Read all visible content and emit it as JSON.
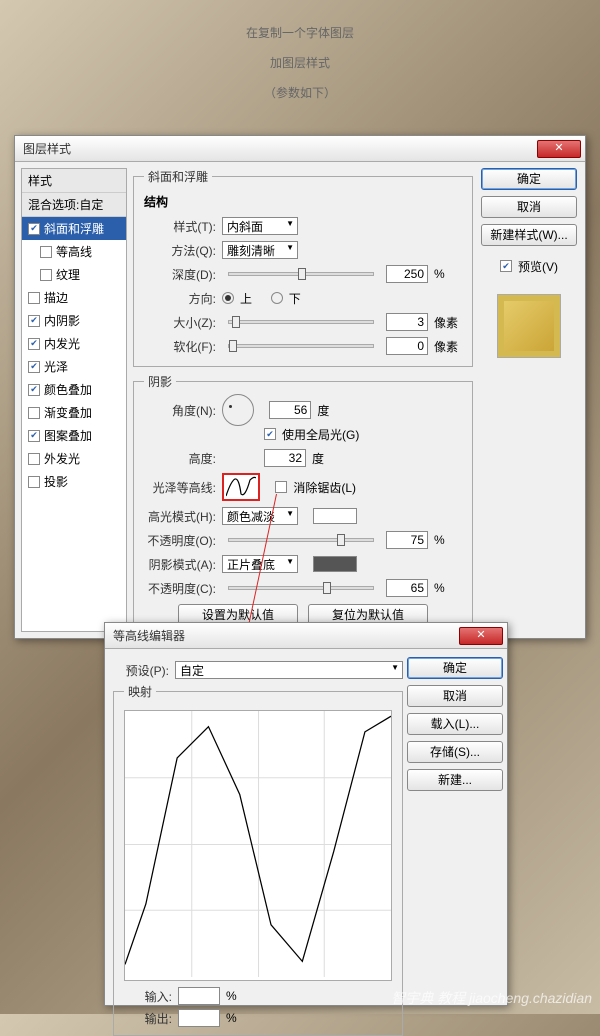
{
  "instruction": {
    "l1": "在复制一个字体图层",
    "l2": "加图层样式",
    "l3": "（参数如下）"
  },
  "dlg1": {
    "title": "图层样式",
    "side": {
      "styles_hdr": "样式",
      "blend_hdr": "混合选项:自定",
      "items": [
        {
          "label": "斜面和浮雕",
          "checked": true,
          "selected": true
        },
        {
          "label": "等高线",
          "checked": false,
          "sub": true
        },
        {
          "label": "纹理",
          "checked": false,
          "sub": true
        },
        {
          "label": "描边",
          "checked": false
        },
        {
          "label": "内阴影",
          "checked": true
        },
        {
          "label": "内发光",
          "checked": true
        },
        {
          "label": "光泽",
          "checked": true
        },
        {
          "label": "颜色叠加",
          "checked": true
        },
        {
          "label": "渐变叠加",
          "checked": false
        },
        {
          "label": "图案叠加",
          "checked": true
        },
        {
          "label": "外发光",
          "checked": false
        },
        {
          "label": "投影",
          "checked": false
        }
      ]
    },
    "bevel": {
      "group": "斜面和浮雕",
      "struct": "结构",
      "style_l": "样式(T):",
      "style_v": "内斜面",
      "tech_l": "方法(Q):",
      "tech_v": "雕刻清晰",
      "depth_l": "深度(D):",
      "depth_v": "250",
      "pct": "%",
      "dir_l": "方向:",
      "up": "上",
      "down": "下",
      "size_l": "大小(Z):",
      "size_v": "3",
      "px": "像素",
      "soft_l": "软化(F):",
      "soft_v": "0"
    },
    "shadow": {
      "group": "阴影",
      "angle_l": "角度(N):",
      "angle_v": "56",
      "deg": "度",
      "global": "使用全局光(G)",
      "global_ck": true,
      "alt_l": "高度:",
      "alt_v": "32",
      "gloss_l": "光泽等高线:",
      "aa": "消除锯齿(L)",
      "aa_ck": false,
      "hmode_l": "高光模式(H):",
      "hmode_v": "颜色减淡",
      "hcol": "#ffffff",
      "hop_l": "不透明度(O):",
      "hop_v": "75",
      "smode_l": "阴影模式(A):",
      "smode_v": "正片叠底",
      "scol": "#555555",
      "sop_l": "不透明度(C):",
      "sop_v": "65"
    },
    "defaults": {
      "set": "设置为默认值",
      "reset": "复位为默认值"
    },
    "btns": {
      "ok": "确定",
      "cancel": "取消",
      "new": "新建样式(W)...",
      "preview": "预览(V)",
      "preview_ck": true
    }
  },
  "dlg2": {
    "title": "等高线编辑器",
    "preset_l": "预设(P):",
    "preset_v": "自定",
    "map": "映射",
    "in_l": "输入:",
    "in_v": "",
    "out_l": "输出:",
    "out_v": "",
    "pct": "%",
    "btns": {
      "ok": "确定",
      "cancel": "取消",
      "load": "载入(L)...",
      "save": "存储(S)...",
      "new": "新建..."
    }
  },
  "chart_data": {
    "type": "line",
    "title": "映射",
    "xlabel": "输入",
    "ylabel": "输出",
    "xlim": [
      0,
      255
    ],
    "ylim": [
      0,
      255
    ],
    "x": [
      0,
      20,
      50,
      80,
      110,
      140,
      170,
      200,
      230,
      255
    ],
    "values": [
      12,
      70,
      210,
      240,
      175,
      50,
      15,
      120,
      235,
      250
    ]
  },
  "watermark": "智宇典 教程 jiaocheng.chazidian"
}
